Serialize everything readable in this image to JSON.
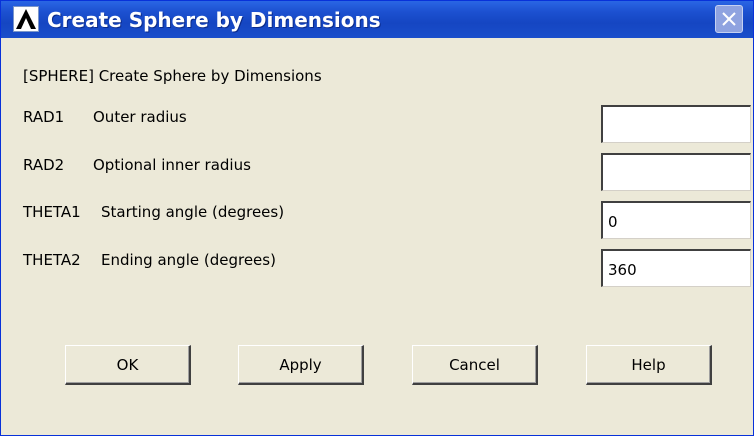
{
  "window": {
    "title": "Create Sphere by Dimensions",
    "icon": "ansys-logo-icon",
    "close_icon": "close-icon",
    "titlebar_color": "#1c50d0"
  },
  "command_label": "[SPHERE]  Create Sphere by Dimensions",
  "fields": [
    {
      "param": "RAD1",
      "description": "Outer radius",
      "value": ""
    },
    {
      "param": "RAD2",
      "description": "Optional inner radius",
      "value": ""
    },
    {
      "param": "THETA1",
      "description": "Starting angle (degrees)",
      "value": "0"
    },
    {
      "param": "THETA2",
      "description": "Ending angle (degrees)",
      "value": "360"
    }
  ],
  "buttons": {
    "ok": "OK",
    "apply": "Apply",
    "cancel": "Cancel",
    "help": "Help"
  }
}
